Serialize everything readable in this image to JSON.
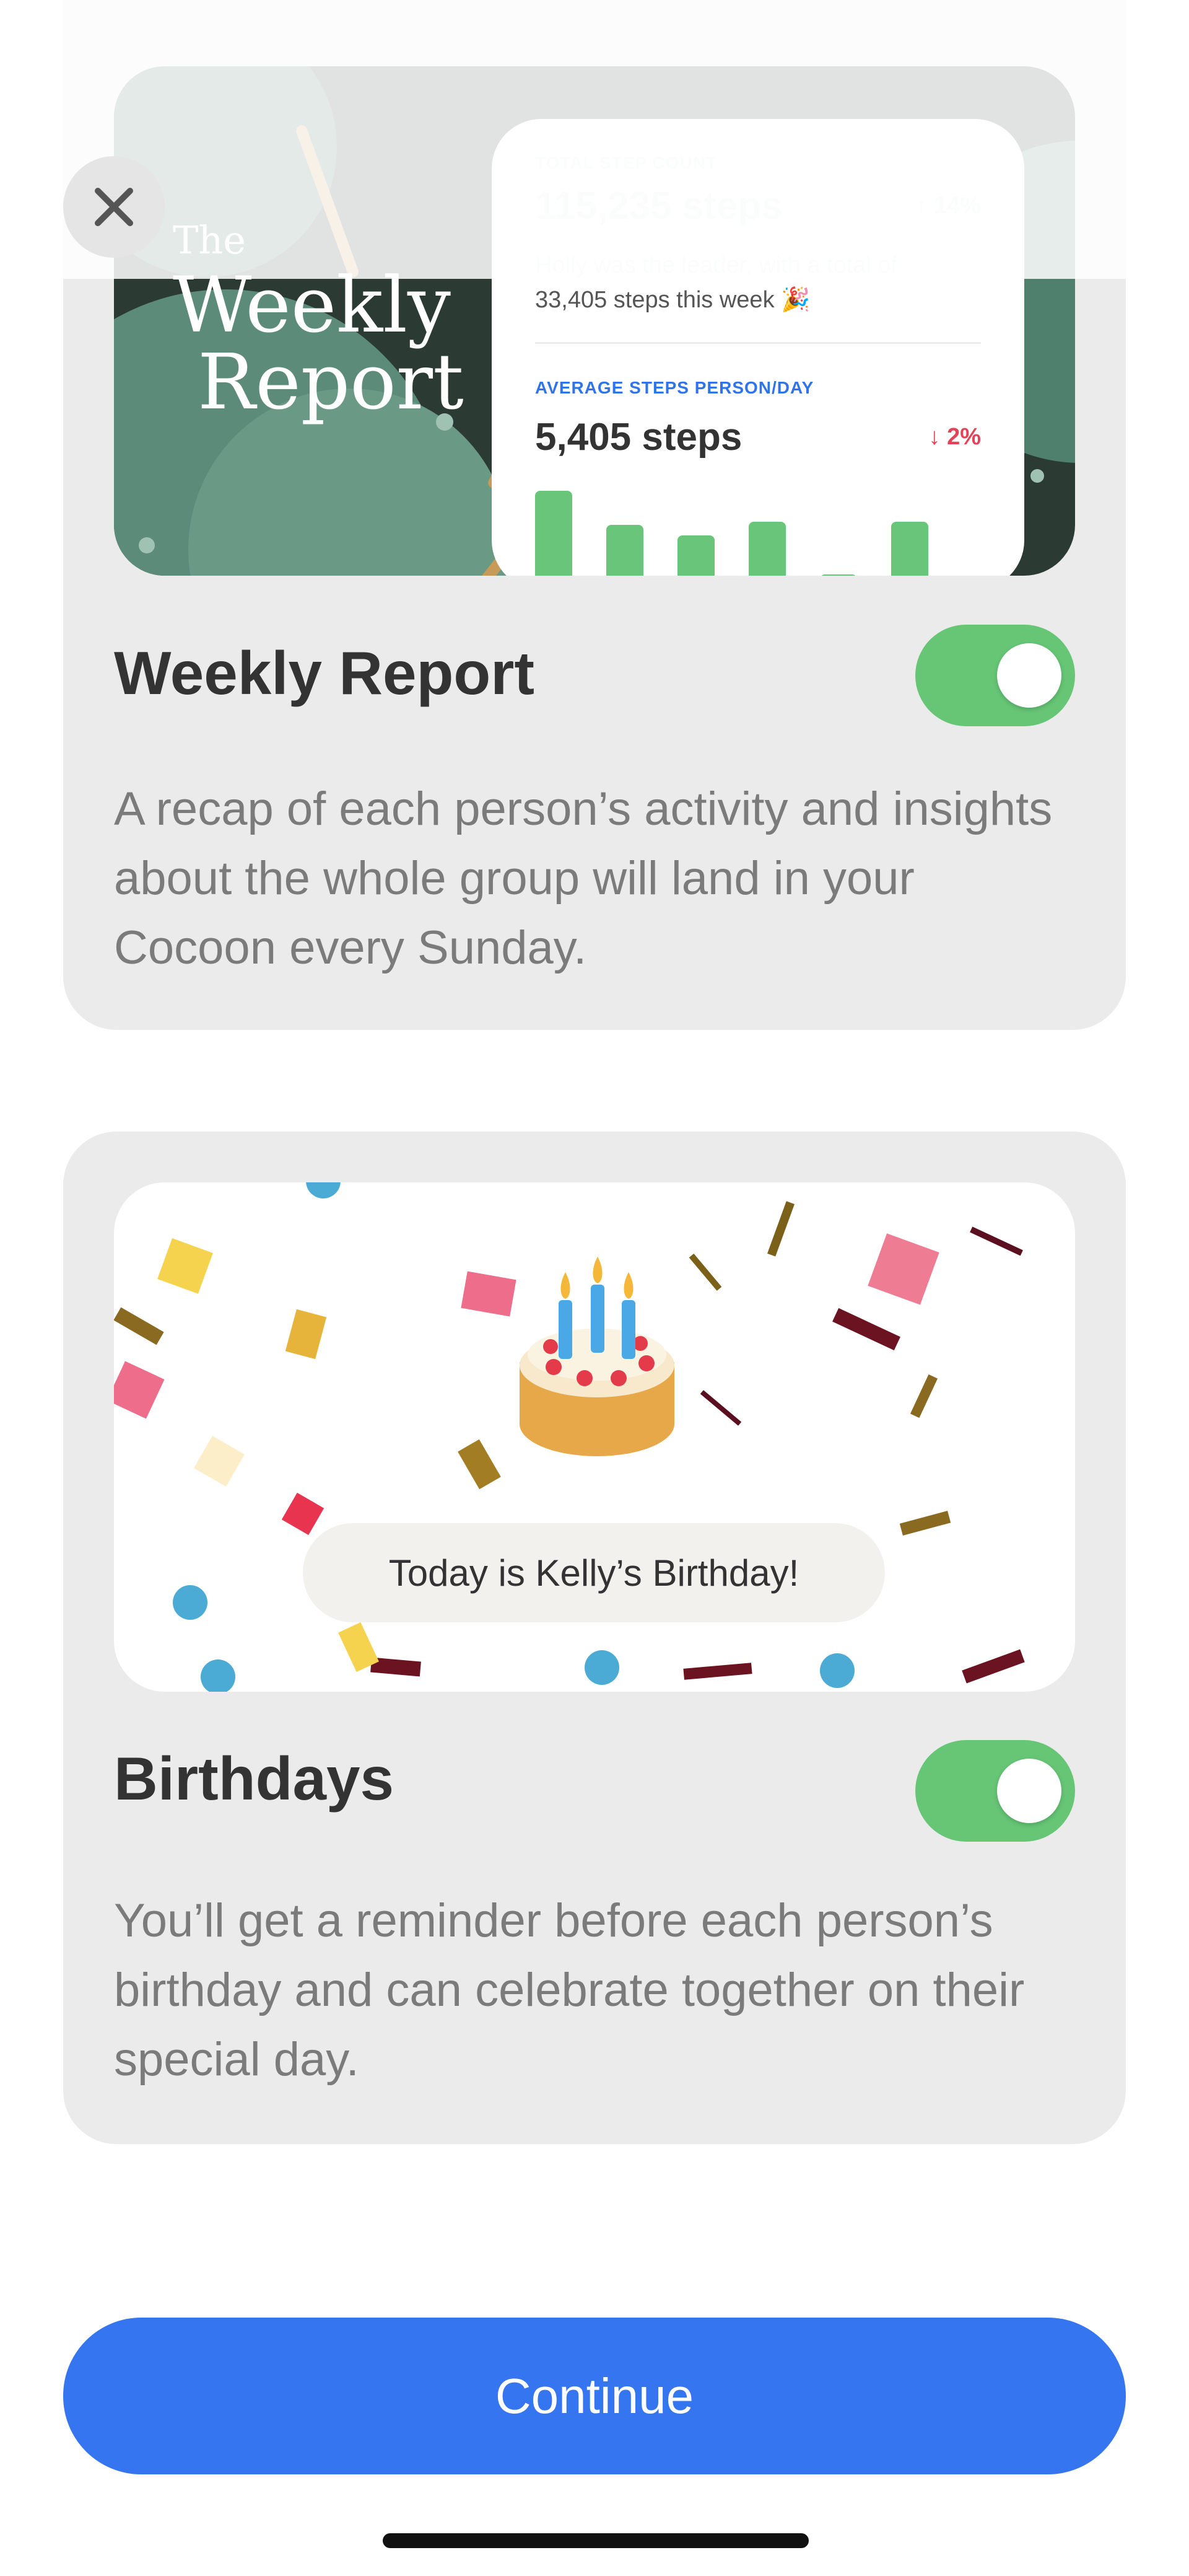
{
  "weekly_report": {
    "hero_title_the": "The",
    "hero_title_weekly": "Weekly",
    "hero_title_report": "Report",
    "total_label": "TOTAL STEP COUNT",
    "total_value": "115,235 steps",
    "total_change": "↑ 14%",
    "leader_name": "Holly",
    "leader_text": " was the leader, with a total of",
    "leader_steps": "33,405 steps this week 🎉",
    "avg_label": "AVERAGE STEPS PERSON/DAY",
    "avg_value": "5,405 steps",
    "avg_change": "↓ 2%",
    "title": "Weekly Report",
    "toggle_on": true,
    "description": "A recap of each person’s activity and insights about the whole group will land in your Cocoon every Sunday."
  },
  "birthdays": {
    "banner": "Today is Kelly’s Birthday!",
    "title": "Birthdays",
    "toggle_on": true,
    "description": "You’ll get a reminder before each person’s birthday and can celebrate together on their special day."
  },
  "continue_label": "Continue",
  "colors": {
    "accent_blue": "#3575f0",
    "toggle_green": "#67c676",
    "card_bg": "#ebebeb",
    "decline_red": "#e44357"
  }
}
